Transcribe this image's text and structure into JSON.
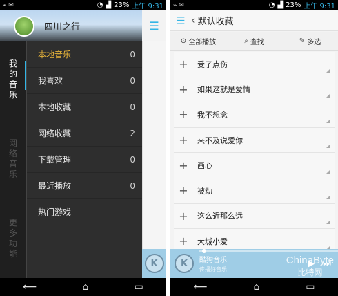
{
  "status_bar": {
    "battery": "23%",
    "time": "上午 9:31"
  },
  "left_screen": {
    "header_title": "四川之行",
    "menu_icon": "menu-icon",
    "tabs": [
      {
        "label": "我的音乐",
        "chars": [
          "我",
          "的",
          "音",
          "乐"
        ]
      },
      {
        "label": "网络音乐",
        "chars": [
          "网",
          "络",
          "音",
          "乐"
        ]
      },
      {
        "label": "更多功能",
        "chars": [
          "更",
          "多",
          "功",
          "能"
        ]
      }
    ],
    "menu_items": [
      {
        "label": "本地音乐",
        "count": "0"
      },
      {
        "label": "我喜欢",
        "count": "0"
      },
      {
        "label": "本地收藏",
        "count": "0"
      },
      {
        "label": "网络收藏",
        "count": "2"
      },
      {
        "label": "下载管理",
        "count": "0"
      },
      {
        "label": "最近播放",
        "count": "0"
      },
      {
        "label": "热门游戏",
        "count": ""
      }
    ]
  },
  "right_screen": {
    "header_title": "默认收藏",
    "toolbar": {
      "play_all": "全部播放",
      "search": "查找",
      "multi_select": "多选"
    },
    "songs": [
      "受了点伤",
      "如果这就是爱情",
      "我不想念",
      "来不及说爱你",
      "画心",
      "被动",
      "这么近那么远",
      "大城小爱"
    ],
    "player": {
      "logo": "K",
      "song": "酷狗音乐",
      "artist": "传播好音乐"
    }
  },
  "watermark": {
    "line1": "ChinaByte",
    "line2": "比特网"
  },
  "colors": {
    "accent": "#33b5e5",
    "active_item": "#e6b33a",
    "player_bg": "#9fcde6"
  }
}
